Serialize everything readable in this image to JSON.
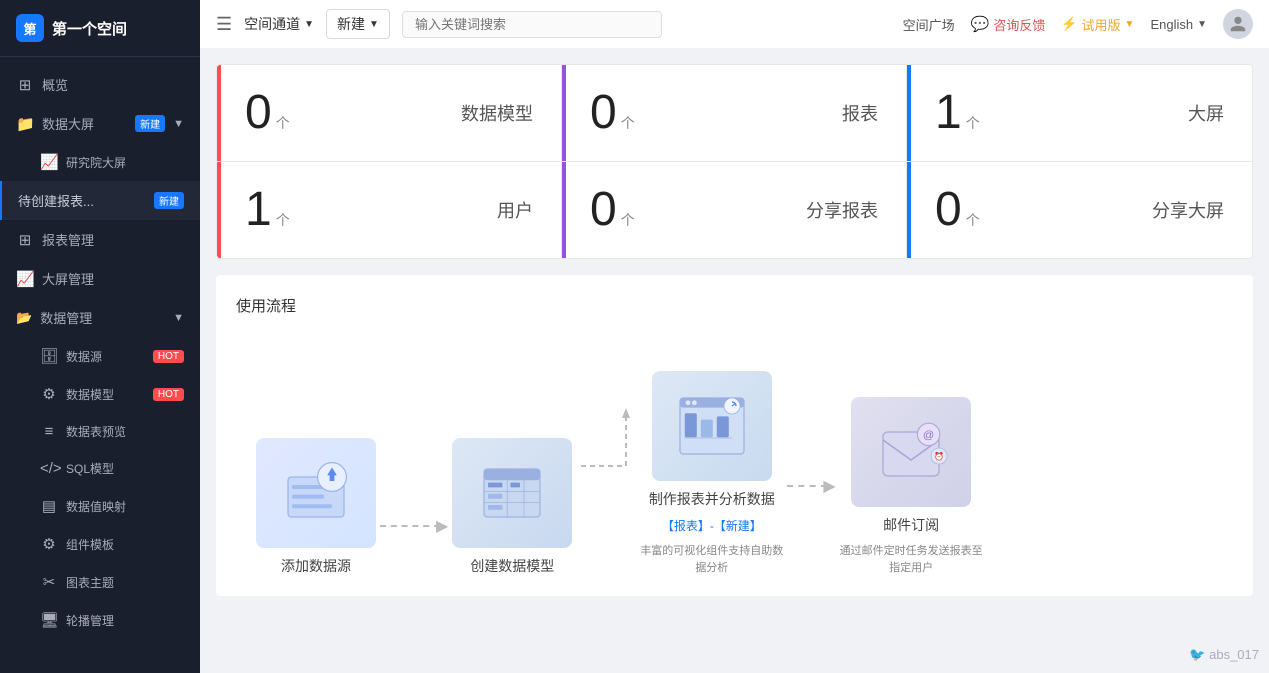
{
  "app": {
    "logo_badge": "第",
    "title": "第一个空间"
  },
  "sidebar": {
    "overview_label": "概览",
    "data_screen_label": "数据大屏",
    "new_badge": "新建",
    "research_screen_label": "研究院大屏",
    "pending_label": "待创建报表...",
    "pending_new_badge": "新建",
    "report_mgmt_label": "报表管理",
    "screen_mgmt_label": "大屏管理",
    "data_mgmt_label": "数据管理",
    "data_source_label": "数据源",
    "data_model_label": "数据模型",
    "data_table_preview_label": "数据表预览",
    "sql_model_label": "SQL模型",
    "data_value_map_label": "数据值映射",
    "component_template_label": "组件模板",
    "chart_theme_label": "图表主题",
    "carousel_mgmt_label": "轮播管理"
  },
  "header": {
    "menu_icon": "☰",
    "channel_label": "空间通道",
    "new_label": "新建",
    "search_placeholder": "输入关键词搜索",
    "space_market_label": "空间广场",
    "consult_label": "咨询反馈",
    "trial_label": "试用版",
    "lang_label": "English"
  },
  "stats": {
    "cards": [
      {
        "number": "0",
        "unit": "个",
        "label": "数据模型",
        "border": "red"
      },
      {
        "number": "0",
        "unit": "个",
        "label": "报表",
        "border": "purple"
      },
      {
        "number": "1",
        "unit": "个",
        "label": "大屏",
        "border": "blue"
      },
      {
        "number": "1",
        "unit": "个",
        "label": "用户",
        "border": "red"
      },
      {
        "number": "0",
        "unit": "个",
        "label": "分享报表",
        "border": "purple"
      },
      {
        "number": "0",
        "unit": "个",
        "label": "分享大屏",
        "border": "blue"
      }
    ]
  },
  "usage_flow": {
    "title": "使用流程",
    "steps": [
      {
        "label": "添加数据源",
        "desc": "",
        "sub": ""
      },
      {
        "label": "创建数据模型",
        "desc": "",
        "sub": ""
      },
      {
        "label": "制作报表并分析数据",
        "desc": "【报表】-【新建】",
        "sub": "丰富的可视化组件支持自助数\n据分析"
      },
      {
        "label": "邮件订阅",
        "desc": "通过邮件定时任务发送报表至\n指定用户",
        "sub": ""
      }
    ]
  },
  "watermark": "abs_017"
}
